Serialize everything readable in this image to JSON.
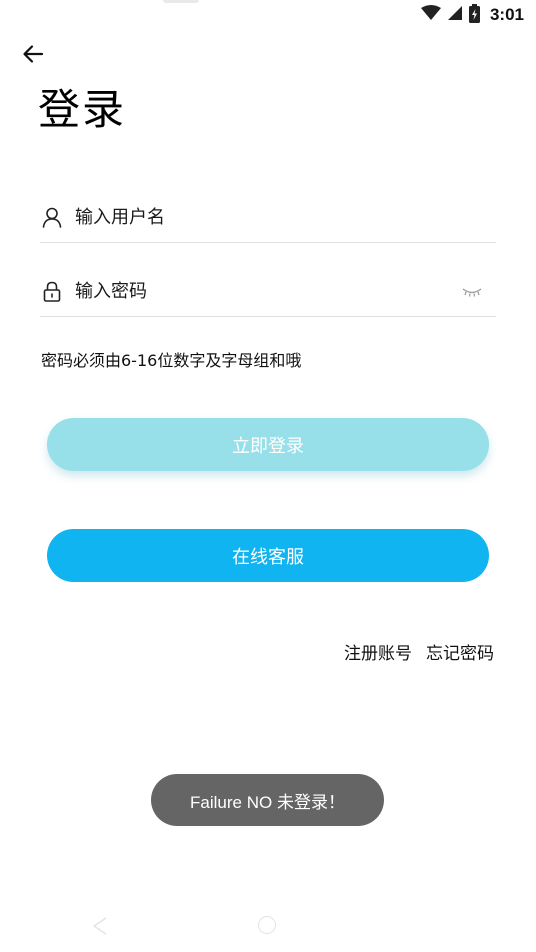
{
  "status_bar": {
    "time": "3:01"
  },
  "page": {
    "title": "登录"
  },
  "form": {
    "username_placeholder": "输入用户名",
    "password_placeholder": "输入密码",
    "username_value": "",
    "password_value": "",
    "hint": "密码必须由6-16位数字及字母组和哦"
  },
  "buttons": {
    "login_label": "立即登录",
    "service_label": "在线客服"
  },
  "links": {
    "register": "注册账号",
    "forgot": "忘记密码"
  },
  "toast": {
    "message": "Failure NO 未登录！"
  },
  "colors": {
    "login_button": "#97dfe9",
    "service_button": "#10b4f0",
    "toast_bg": "#656565"
  }
}
